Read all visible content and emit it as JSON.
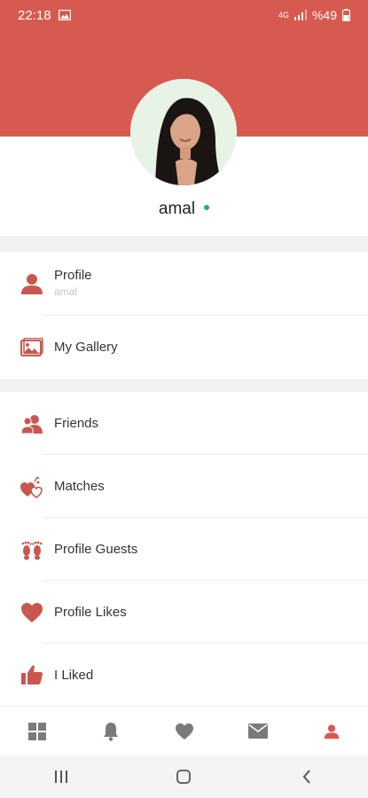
{
  "status_bar": {
    "time": "22:18",
    "battery": "%49",
    "network": "4G"
  },
  "profile": {
    "username": "amal",
    "online_color": "#2bb34a"
  },
  "menu": {
    "group1": [
      {
        "label": "Profile",
        "sub": "amal",
        "icon": "person-icon"
      },
      {
        "label": "My Gallery",
        "icon": "gallery-icon"
      }
    ],
    "group2": [
      {
        "label": "Friends",
        "icon": "friends-icon"
      },
      {
        "label": "Matches",
        "icon": "matches-icon"
      },
      {
        "label": "Profile Guests",
        "icon": "footprints-icon"
      },
      {
        "label": "Profile Likes",
        "icon": "heart-icon"
      },
      {
        "label": "I Liked",
        "icon": "thumbs-up-icon"
      }
    ]
  },
  "bottom_nav": [
    "grid-icon",
    "bell-icon",
    "heart-icon",
    "mail-icon",
    "person-icon"
  ],
  "colors": {
    "accent": "#d65a50",
    "icon": "#c8584f",
    "nav_inactive": "#7a7a7a",
    "nav_active": "#d65a50"
  }
}
